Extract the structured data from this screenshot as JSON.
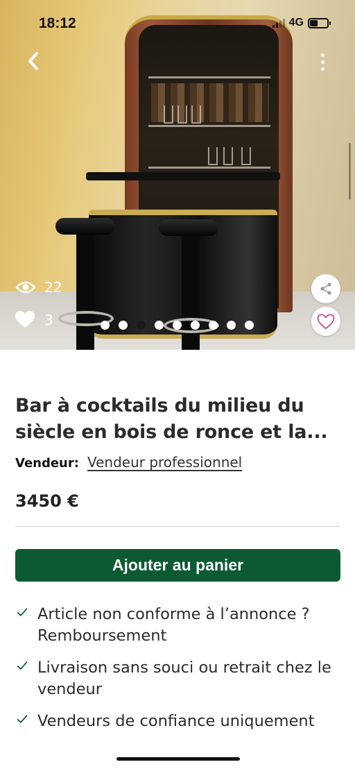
{
  "status_bar": {
    "time": "18:12",
    "network": "4G",
    "battery_level": 0.45
  },
  "hero": {
    "views_count": "22",
    "likes_count": "3",
    "carousel_total": 9,
    "carousel_active": 3
  },
  "product": {
    "title": "Bar à cocktails du milieu du siècle en bois de ronce et la...",
    "seller_label": "Vendeur:",
    "seller_name": "Vendeur professionnel",
    "price": "3450 €"
  },
  "actions": {
    "add_to_cart": "Ajouter au panier"
  },
  "features": [
    "Article non conforme à l’annonce ? Remboursement",
    "Livraison sans souci ou retrait chez le vendeur",
    "Vendeurs de confiance uniquement"
  ],
  "colors": {
    "primary_green": "#0c5a32",
    "favorite_pink": "#d6499a"
  },
  "icons": [
    "back-arrow-icon",
    "more-vertical-icon",
    "eye-icon",
    "heart-icon",
    "share-icon",
    "heart-outline-icon",
    "check-icon"
  ]
}
